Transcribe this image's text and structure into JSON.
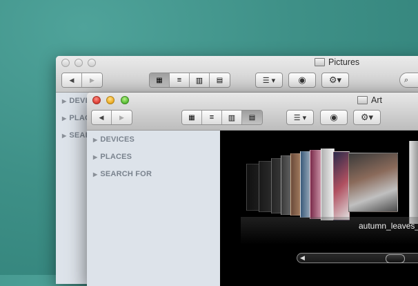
{
  "back_window": {
    "title": "Pictures",
    "sidebar": [
      {
        "label": "DEVI"
      },
      {
        "label": "PLAC"
      },
      {
        "label": "SEAR"
      }
    ]
  },
  "front_window": {
    "title": "Art",
    "sidebar": [
      {
        "label": "DEVICES"
      },
      {
        "label": "PLACES"
      },
      {
        "label": "SEARCH FOR"
      }
    ],
    "view_modes": [
      "icon-view",
      "list-view",
      "column-view",
      "cover-flow-view"
    ],
    "selected_view": "cover-flow-view",
    "coverflow": {
      "selected_file": "autumn_leaves_"
    }
  },
  "colors": {
    "desktop": "#3e9087",
    "sidebar": "#dde3ea",
    "coverflow_bg": "#000000"
  },
  "icons": [
    "back-arrow-icon",
    "forward-arrow-icon",
    "arrange-icon",
    "quick-look-eye-icon",
    "gear-icon",
    "search-icon",
    "folder-icon"
  ]
}
